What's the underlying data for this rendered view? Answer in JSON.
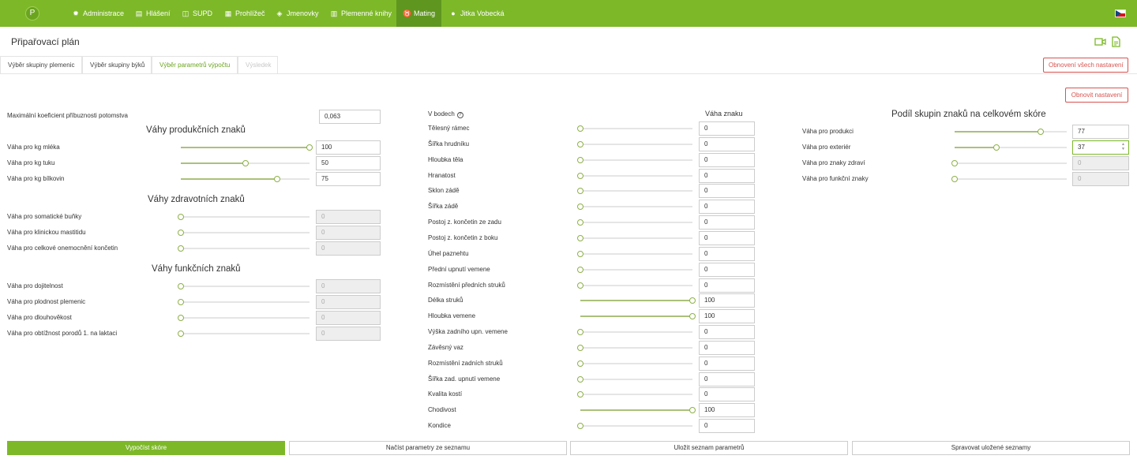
{
  "nav": {
    "logo": "P",
    "items": [
      {
        "label": "Administrace",
        "icon": "gear-icon",
        "glyph": "✹"
      },
      {
        "label": "Hlášení",
        "icon": "clipboard-icon",
        "glyph": "▤"
      },
      {
        "label": "SUPD",
        "icon": "database-icon",
        "glyph": "◫"
      },
      {
        "label": "Prohlížeč",
        "icon": "search-document-icon",
        "glyph": "▦"
      },
      {
        "label": "Jmenovky",
        "icon": "tag-icon",
        "glyph": "◈"
      },
      {
        "label": "Plemenné knihy",
        "icon": "book-icon",
        "glyph": "▥"
      },
      {
        "label": "Mating",
        "icon": "bull-icon",
        "glyph": "♉"
      },
      {
        "label": "Jitka Vobecká",
        "icon": "user-icon",
        "glyph": "●"
      }
    ],
    "active_index": 6,
    "language": "cz-flag-icon"
  },
  "page": {
    "title": "Připařovací plán",
    "icons": [
      "video-icon",
      "document-icon"
    ]
  },
  "tabs": [
    {
      "label": "Výběr skupiny plemenic",
      "state": "normal"
    },
    {
      "label": "Výběr skupiny býků",
      "state": "normal"
    },
    {
      "label": "Výběr parametrů výpočtu",
      "state": "active"
    },
    {
      "label": "Výsledek",
      "state": "disabled"
    }
  ],
  "buttons": {
    "reset_all": "Obnovení všech nastavení",
    "reset": "Obnovit nastavení"
  },
  "left": {
    "max_kinship": {
      "label": "Maximální koeficient příbuznosti potomstva",
      "value": "0,063"
    },
    "production": {
      "title": "Váhy produkčních znaků",
      "rows": [
        {
          "label": "Váha pro kg mléka",
          "value": "100",
          "fraction": 1.0,
          "disabled": false
        },
        {
          "label": "Váha pro kg tuku",
          "value": "50",
          "fraction": 0.5,
          "disabled": false
        },
        {
          "label": "Váha pro kg bílkovin",
          "value": "75",
          "fraction": 0.75,
          "disabled": false
        }
      ]
    },
    "health": {
      "title": "Váhy zdravotních znaků",
      "rows": [
        {
          "label": "Váha pro somatické buňky",
          "value": "0",
          "fraction": 0,
          "disabled": true
        },
        {
          "label": "Váha pro klinickou mastitidu",
          "value": "0",
          "fraction": 0,
          "disabled": true
        },
        {
          "label": "Váha pro celkové onemocnění končetin",
          "value": "0",
          "fraction": 0,
          "disabled": true
        }
      ]
    },
    "functional": {
      "title": "Váhy funkčních znaků",
      "rows": [
        {
          "label": "Váha pro dojitelnost",
          "value": "0",
          "fraction": 0,
          "disabled": true
        },
        {
          "label": "Váha pro plodnost plemenic",
          "value": "0",
          "fraction": 0,
          "disabled": true
        },
        {
          "label": "Váha pro dlouhověkost",
          "value": "0",
          "fraction": 0,
          "disabled": true
        },
        {
          "label": "Váha pro obtížnost porodů 1. na laktaci",
          "value": "0",
          "fraction": 0,
          "disabled": true
        }
      ]
    }
  },
  "middle": {
    "header_label": "V bodech",
    "column_title": "Váha znaku",
    "rows": [
      {
        "label": "Tělesný rámec",
        "value": "0",
        "fraction": 0
      },
      {
        "label": "Šířka hrudníku",
        "value": "0",
        "fraction": 0
      },
      {
        "label": "Hloubka těla",
        "value": "0",
        "fraction": 0
      },
      {
        "label": "Hranatost",
        "value": "0",
        "fraction": 0
      },
      {
        "label": "Sklon zádě",
        "value": "0",
        "fraction": 0
      },
      {
        "label": "Šířka zádě",
        "value": "0",
        "fraction": 0
      },
      {
        "label": "Postoj z. končetin ze zadu",
        "value": "0",
        "fraction": 0
      },
      {
        "label": "Postoj z. končetin z boku",
        "value": "0",
        "fraction": 0
      },
      {
        "label": "Úhel paznehtu",
        "value": "0",
        "fraction": 0
      },
      {
        "label": "Přední upnutí vemene",
        "value": "0",
        "fraction": 0
      },
      {
        "label": "Rozmístění předních struků",
        "value": "0",
        "fraction": 0
      },
      {
        "label": "Délka struků",
        "value": "100",
        "fraction": 1.0
      },
      {
        "label": "Hloubka vemene",
        "value": "100",
        "fraction": 1.0
      },
      {
        "label": "Výška zadního upn. vemene",
        "value": "0",
        "fraction": 0
      },
      {
        "label": "Závěsný vaz",
        "value": "0",
        "fraction": 0
      },
      {
        "label": "Rozmístění zadních struků",
        "value": "0",
        "fraction": 0
      },
      {
        "label": "Šířka zad. upnutí vemene",
        "value": "0",
        "fraction": 0
      },
      {
        "label": "Kvalita kostí",
        "value": "0",
        "fraction": 0
      },
      {
        "label": "Chodivost",
        "value": "100",
        "fraction": 1.0
      },
      {
        "label": "Kondice",
        "value": "0",
        "fraction": 0
      }
    ]
  },
  "right": {
    "title": "Podíl skupin znaků na celkovém skóre",
    "rows": [
      {
        "label": "Váha pro produkci",
        "value": "77",
        "fraction": 0.77,
        "disabled": false,
        "focused": false
      },
      {
        "label": "Váha pro exteriér",
        "value": "37",
        "fraction": 0.37,
        "disabled": false,
        "focused": true
      },
      {
        "label": "Váha pro znaky zdraví",
        "value": "0",
        "fraction": 0,
        "disabled": true,
        "focused": false
      },
      {
        "label": "Váha pro funkční znaky",
        "value": "0",
        "fraction": 0,
        "disabled": true,
        "focused": false
      }
    ]
  },
  "bottom": {
    "calc": "Vypočíst skóre",
    "load": "Načíst parametry ze seznamu",
    "save": "Uložit seznam parametrů",
    "manage": "Spravovat uložené seznamy"
  }
}
